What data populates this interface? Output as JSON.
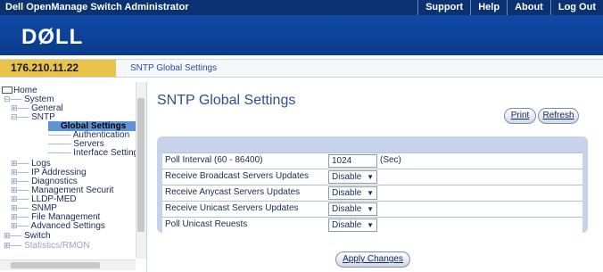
{
  "topbar": {
    "app_title": "Dell OpenManage Switch Administrator",
    "nav": [
      "Support",
      "Help",
      "About",
      "Log Out"
    ]
  },
  "banner": {
    "logo": "DØLL"
  },
  "ipbar": {
    "ip": "176.210.11.22",
    "breadcrumb": "SNTP Global Settings"
  },
  "tree": {
    "items": [
      {
        "label": "Home"
      },
      {
        "label": "System"
      },
      {
        "label": "General"
      },
      {
        "label": "SNTP"
      },
      {
        "label": "Global Settings"
      },
      {
        "label": "Authentication"
      },
      {
        "label": "Servers"
      },
      {
        "label": "Interface Settings"
      },
      {
        "label": "Logs"
      },
      {
        "label": "IP Addressing"
      },
      {
        "label": "Diagnostics"
      },
      {
        "label": "Management Securit"
      },
      {
        "label": "LLDP-MED"
      },
      {
        "label": "SNMP"
      },
      {
        "label": "File Management"
      },
      {
        "label": "Advanced Settings"
      },
      {
        "label": "Switch"
      },
      {
        "label": "Statistics/RMON"
      }
    ]
  },
  "main": {
    "title": "SNTP Global Settings",
    "print_label": "Print",
    "refresh_label": "Refresh",
    "apply_label": "Apply Changes",
    "rows": [
      {
        "label": "Poll Interval (60 - 86400)",
        "value": "1024",
        "unit": "(Sec)"
      },
      {
        "label": "Receive Broadcast Servers Updates",
        "value": "Disable"
      },
      {
        "label": "Receive Anycast Servers Updates",
        "value": "Disable"
      },
      {
        "label": "Receive Unicast Servers Updates",
        "value": "Disable"
      },
      {
        "label": "Poll Unicast Reuests",
        "value": "Disable"
      }
    ]
  },
  "colors": {
    "topbar": "#0a3272",
    "banner": "#0f4aa5",
    "ip_box": "#e9c24a",
    "selected": "#5e94d6",
    "panel": "#c7d3ea"
  }
}
